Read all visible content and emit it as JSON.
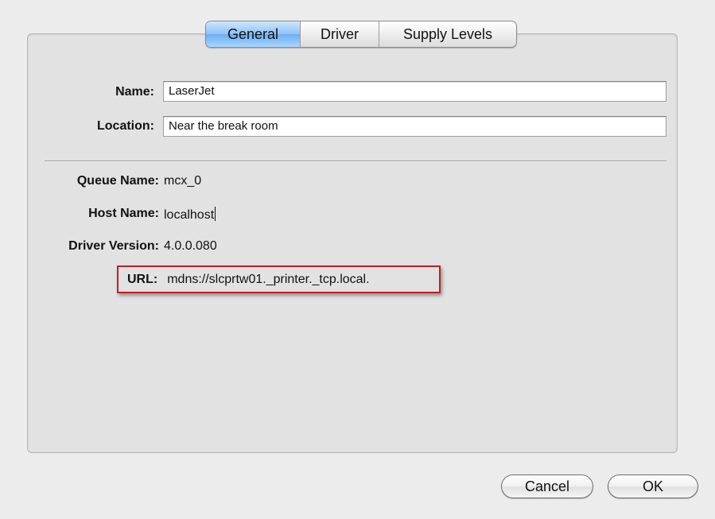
{
  "tabs": [
    {
      "label": "General",
      "active": true
    },
    {
      "label": "Driver",
      "active": false
    },
    {
      "label": "Supply Levels",
      "active": false
    }
  ],
  "fields": {
    "name": {
      "label": "Name:",
      "value": "LaserJet"
    },
    "location": {
      "label": "Location:",
      "value": "Near the break room"
    }
  },
  "info": {
    "queue_name": {
      "label": "Queue Name:",
      "value": "mcx_0"
    },
    "host_name": {
      "label": "Host Name:",
      "value": "localhost"
    },
    "driver_version": {
      "label": "Driver Version:",
      "value": "4.0.0.080"
    },
    "url": {
      "label": "URL:",
      "value": "mdns://slcprtw01._printer._tcp.local."
    }
  },
  "buttons": {
    "cancel": "Cancel",
    "ok": "OK"
  },
  "colors": {
    "highlight_border": "#c41e2a",
    "active_tab": "#8ec2f5"
  }
}
